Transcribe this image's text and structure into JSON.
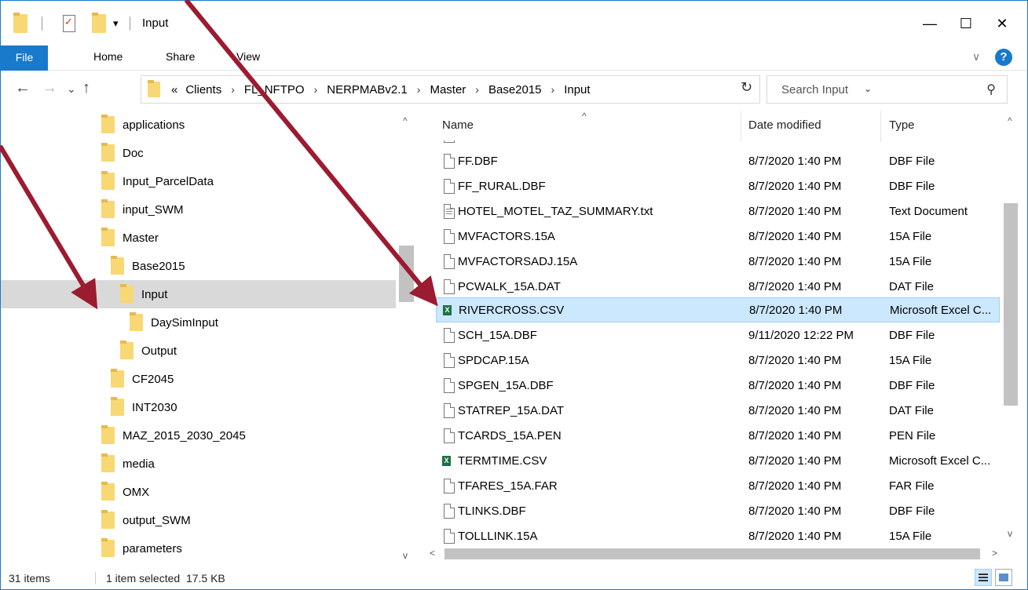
{
  "window": {
    "title": "Input",
    "controls": {
      "minimize": "—",
      "maximize": "☐",
      "close": "✕"
    }
  },
  "quick_access": {
    "dropdown_glyph": "▾"
  },
  "ribbon": {
    "file_tab": "File",
    "tabs": [
      "Home",
      "Share",
      "View"
    ],
    "expand_glyph": "∨",
    "help_glyph": "?"
  },
  "navigation": {
    "back_glyph": "←",
    "forward_glyph": "→",
    "recent_glyph": "⌄",
    "up_glyph": "↑",
    "overflow_glyph": "«",
    "breadcrumb": [
      "Clients",
      "FL_NFTPO",
      "NERPMABv2.1",
      "Master",
      "Base2015",
      "Input"
    ],
    "crumb_separator": "›",
    "dropdown_glyph": "⌄",
    "refresh_glyph": "↻"
  },
  "search": {
    "placeholder": "Search Input",
    "icon": "search-icon",
    "icon_glyph": "⚲"
  },
  "tree": {
    "items": [
      {
        "label": "applications"
      },
      {
        "label": "Doc"
      },
      {
        "label": "Input_ParcelData"
      },
      {
        "label": "input_SWM"
      },
      {
        "label": "Master"
      },
      {
        "label": "Base2015"
      },
      {
        "label": "Input"
      },
      {
        "label": "DaySimInput"
      },
      {
        "label": "Output"
      },
      {
        "label": "CF2045"
      },
      {
        "label": "INT2030"
      },
      {
        "label": "MAZ_2015_2030_2045"
      },
      {
        "label": "media"
      },
      {
        "label": "OMX"
      },
      {
        "label": "output_SWM"
      },
      {
        "label": "parameters"
      }
    ],
    "selected": "Input",
    "scroll_up": "^",
    "scroll_down": "v"
  },
  "file_list": {
    "columns": {
      "name": "Name",
      "date": "Date modified",
      "type": "Type"
    },
    "sort_glyph": "^",
    "files": [
      {
        "name": "FF.DBF",
        "date": "8/7/2020 1:40 PM",
        "type": "DBF File",
        "icon": "file-icon"
      },
      {
        "name": "FF_RURAL.DBF",
        "date": "8/7/2020 1:40 PM",
        "type": "DBF File",
        "icon": "file-icon"
      },
      {
        "name": "HOTEL_MOTEL_TAZ_SUMMARY.txt",
        "date": "8/7/2020 1:40 PM",
        "type": "Text Document",
        "icon": "text-file-icon"
      },
      {
        "name": "MVFACTORS.15A",
        "date": "8/7/2020 1:40 PM",
        "type": "15A File",
        "icon": "file-icon"
      },
      {
        "name": "MVFACTORSADJ.15A",
        "date": "8/7/2020 1:40 PM",
        "type": "15A File",
        "icon": "file-icon"
      },
      {
        "name": "PCWALK_15A.DAT",
        "date": "8/7/2020 1:40 PM",
        "type": "DAT File",
        "icon": "file-icon"
      },
      {
        "name": "RIVERCROSS.CSV",
        "date": "8/7/2020 1:40 PM",
        "type": "Microsoft Excel C...",
        "icon": "excel-csv-icon",
        "selected": true
      },
      {
        "name": "SCH_15A.DBF",
        "date": "9/11/2020 12:22 PM",
        "type": "DBF File",
        "icon": "file-icon"
      },
      {
        "name": "SPDCAP.15A",
        "date": "8/7/2020 1:40 PM",
        "type": "15A File",
        "icon": "file-icon"
      },
      {
        "name": "SPGEN_15A.DBF",
        "date": "8/7/2020 1:40 PM",
        "type": "DBF File",
        "icon": "file-icon"
      },
      {
        "name": "STATREP_15A.DAT",
        "date": "8/7/2020 1:40 PM",
        "type": "DAT File",
        "icon": "file-icon"
      },
      {
        "name": "TCARDS_15A.PEN",
        "date": "8/7/2020 1:40 PM",
        "type": "PEN File",
        "icon": "file-icon"
      },
      {
        "name": "TERMTIME.CSV",
        "date": "8/7/2020 1:40 PM",
        "type": "Microsoft Excel C...",
        "icon": "excel-csv-icon"
      },
      {
        "name": "TFARES_15A.FAR",
        "date": "8/7/2020 1:40 PM",
        "type": "FAR File",
        "icon": "file-icon"
      },
      {
        "name": "TLINKS.DBF",
        "date": "8/7/2020 1:40 PM",
        "type": "DBF File",
        "icon": "file-icon"
      },
      {
        "name": "TOLLLINK.15A",
        "date": "8/7/2020 1:40 PM",
        "type": "15A File",
        "icon": "file-icon"
      }
    ],
    "excel_badge": "X",
    "scroll_left": "<",
    "scroll_right": ">",
    "scroll_up": "^",
    "scroll_down": "v"
  },
  "status": {
    "item_count": "31 items",
    "selection": "1 item selected  17.5 KB"
  },
  "colors": {
    "accent": "#1979ca",
    "selection_bg": "#cce8ff",
    "tree_selection_bg": "#d9d9d9",
    "folder": "#f8d775",
    "annotation_arrow": "#9b1b30"
  }
}
